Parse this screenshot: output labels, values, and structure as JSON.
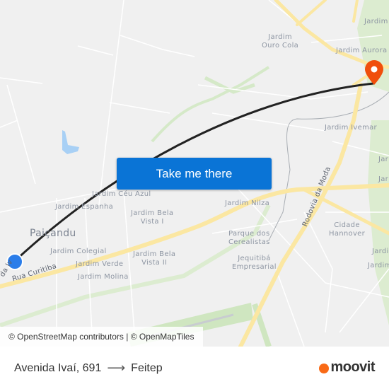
{
  "map": {
    "labels": {
      "jardim_ouro_cola": "Jardim\nOuro Cola",
      "jardim_top_right": "Jardim",
      "jardim_aurora": "Jardim Aurora",
      "jardim_ivemar": "Jardim Ivemar",
      "jardim_ceu_azul": "Jardim Céu Azul",
      "jardim_espanha": "Jardim Espanha",
      "jardim_bela_vista_1": "Jardim Bela\nVista I",
      "paicandu": "Paiçandu",
      "jardim_colegial": "Jardim Colegial",
      "jardim_verde": "Jardim Verde",
      "jardim_bela_vista_2": "Jardim Bela\nVista II",
      "jardim_molina": "Jardim Molina",
      "jardim_nilza": "Jardim Nilza",
      "parque_dos_cerealistas": "Parque dos\nCerealistas",
      "jequitiba_empresarial": "Jequitibá\nEmpresarial",
      "cidade_hannover": "Cidade\nHannover",
      "jardim_right_1": "Jar",
      "jardim_right_2": "Jar",
      "jardim_right_3": "Jardi",
      "jardim_right_4": "Jardim",
      "rua_curitiba": "Rua Curitiba",
      "avenida_ivai": "da Iv",
      "rodovia_da_moda": "Rodovia da Moda"
    },
    "origin_color": "#2b7de9",
    "destination_color": "#f04e0c",
    "route_color": "#222222"
  },
  "cta": {
    "label": "Take me there"
  },
  "attribution": "© OpenStreetMap contributors | © OpenMapTiles",
  "footer": {
    "origin": "Avenida Ivaí, 691",
    "arrow": "⟶",
    "destination": "Feitep",
    "brand": "moovit"
  }
}
